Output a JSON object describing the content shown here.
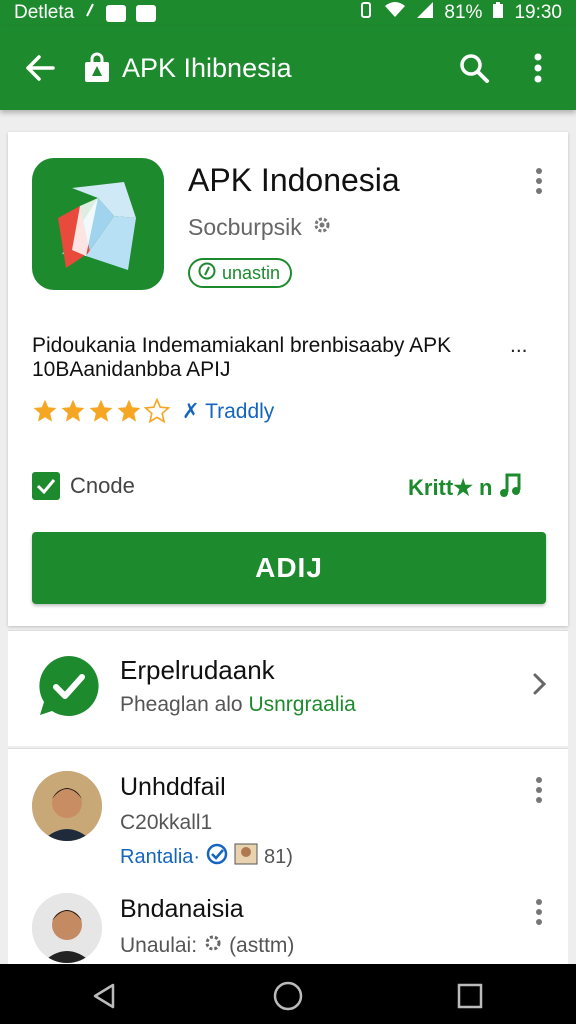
{
  "status_bar": {
    "carrier": "Detleta",
    "battery": "81%",
    "time": "19:30"
  },
  "app_bar": {
    "title": "APK Ihibnesia",
    "icons": [
      "back-arrow-icon",
      "shopping-bag-icon",
      "search-icon",
      "more-vert-icon"
    ]
  },
  "app": {
    "name": "APK Indonesia",
    "developer": "Socburpsik",
    "badge": "unastin",
    "description_line1": "Pidoukania Indemamiakanl brenbisaaby APK",
    "description_more": "...",
    "description_line2": "10BAanidanbba APIJ",
    "rating_stars": 4,
    "rating_max": 5,
    "rating_label": "Traddly",
    "checkbox_label": "Cnode",
    "green_label": "Kritt★ n",
    "install_label": "ADIJ"
  },
  "promo": {
    "title": "Erpelrudaank",
    "subtitle_prefix": "Pheaglan alo",
    "subtitle_accent": "Usnrgraalia"
  },
  "reviews": [
    {
      "name": "Unhddfail",
      "line": "C20kkall1",
      "meta": "Rantalia·",
      "meta_extra": "81)"
    },
    {
      "name": "Bndanaisia",
      "line": "Unaulai:",
      "meta": "",
      "meta_extra": "(asttm)"
    }
  ],
  "colors": {
    "primary_green": "#1e8a2e",
    "link_blue": "#1565c0",
    "star_orange": "#f5a623"
  }
}
